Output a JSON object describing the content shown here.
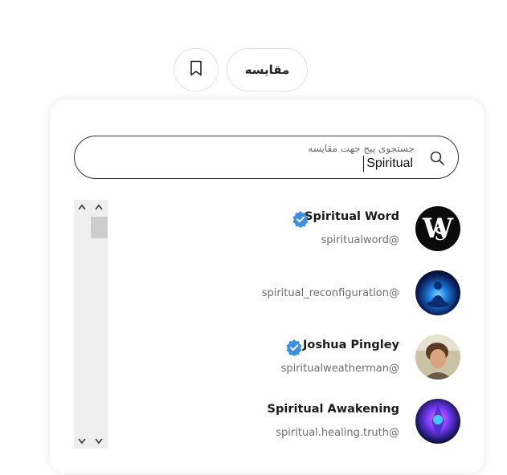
{
  "toolbar": {
    "bookmark_icon": "bookmark-icon",
    "compare_label": "مقایسه"
  },
  "search": {
    "label": "جستجوی پیج جهت مقایسه",
    "value": "Spiritual",
    "icon": "search-icon"
  },
  "results": [
    {
      "name": "Spiritual Word",
      "handle": "spiritualword@",
      "verified": true
    },
    {
      "name": "",
      "handle": "spiritual_reconfiguration@",
      "verified": false
    },
    {
      "name": "Joshua Pingley",
      "handle": "spiritualweatherman@",
      "verified": true
    },
    {
      "name": "Spiritual Awakening",
      "handle": "spiritual.healing.truth@",
      "verified": false
    }
  ],
  "colors": {
    "verified_badge": "#3b8ee0",
    "border": "#333333",
    "scrollbar_track": "#efefef",
    "scrollbar_thumb": "#cdcdcd"
  }
}
